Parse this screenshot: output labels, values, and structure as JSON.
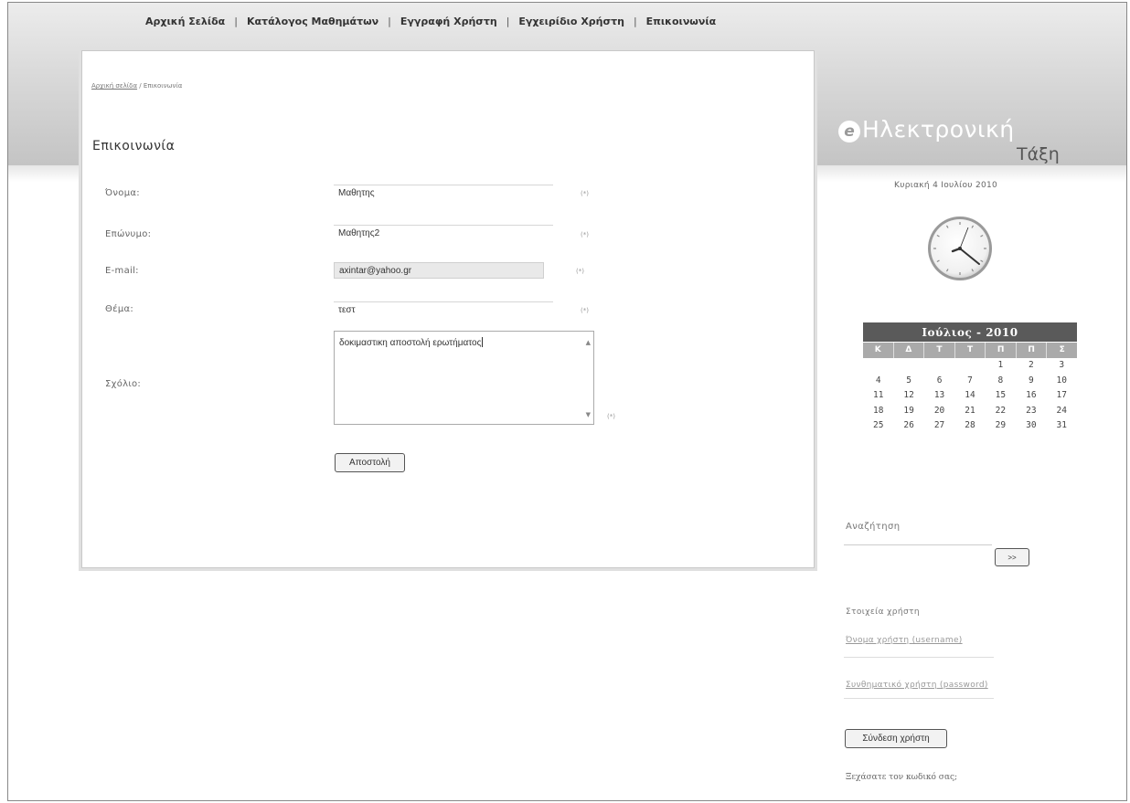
{
  "nav": {
    "items": [
      "Αρχική Σελίδα",
      "Κατάλογος Μαθημάτων",
      "Εγγραφή Χρήστη",
      "Εγχειρίδιο Χρήστη",
      "Επικοινωνία"
    ],
    "separator": "|"
  },
  "breadcrumb": {
    "home": "Αρχική σελίδα",
    "sep": "/",
    "current": "Επικοινωνία"
  },
  "page_title": "Επικοινωνία",
  "form": {
    "name_label": "Όνομα:",
    "name_value": "Μαθητης",
    "surname_label": "Επώνυμο:",
    "surname_value": "Μαθητης2",
    "email_label": "E-mail:",
    "email_value": "axintar@yahoo.gr",
    "subject_label": "Θέμα:",
    "subject_value": "τεστ",
    "comment_label": "Σχόλιο:",
    "comment_value": "δοκιμαστικη αποστολή ερωτήματος",
    "required": "(*)",
    "submit": "Αποστολή"
  },
  "logo": {
    "mark": "e",
    "word1": "Ηλεκτρονική",
    "word2": "Τάξη"
  },
  "date": "Κυριακή 4 Ιουλίου 2010",
  "calendar": {
    "title": "Ιούλιος - 2010",
    "day_headers": [
      "Κ",
      "Δ",
      "Τ",
      "Τ",
      "Π",
      "Π",
      "Σ"
    ],
    "weeks": [
      [
        "",
        "",
        "",
        "",
        "1",
        "2",
        "3"
      ],
      [
        "4",
        "5",
        "6",
        "7",
        "8",
        "9",
        "10"
      ],
      [
        "11",
        "12",
        "13",
        "14",
        "15",
        "16",
        "17"
      ],
      [
        "18",
        "19",
        "20",
        "21",
        "22",
        "23",
        "24"
      ],
      [
        "25",
        "26",
        "27",
        "28",
        "29",
        "30",
        "31"
      ]
    ]
  },
  "search": {
    "title": "Αναζήτηση",
    "button": ">>"
  },
  "login": {
    "title": "Στοιχεία χρήστη",
    "username_label": "Όνομα χρήστη (username)",
    "password_label": "Συνθηματικό χρήστη (password)",
    "button": "Σύνδεση χρήστη",
    "forgot": "Ξεχάσατε τον κωδικό σας;"
  }
}
